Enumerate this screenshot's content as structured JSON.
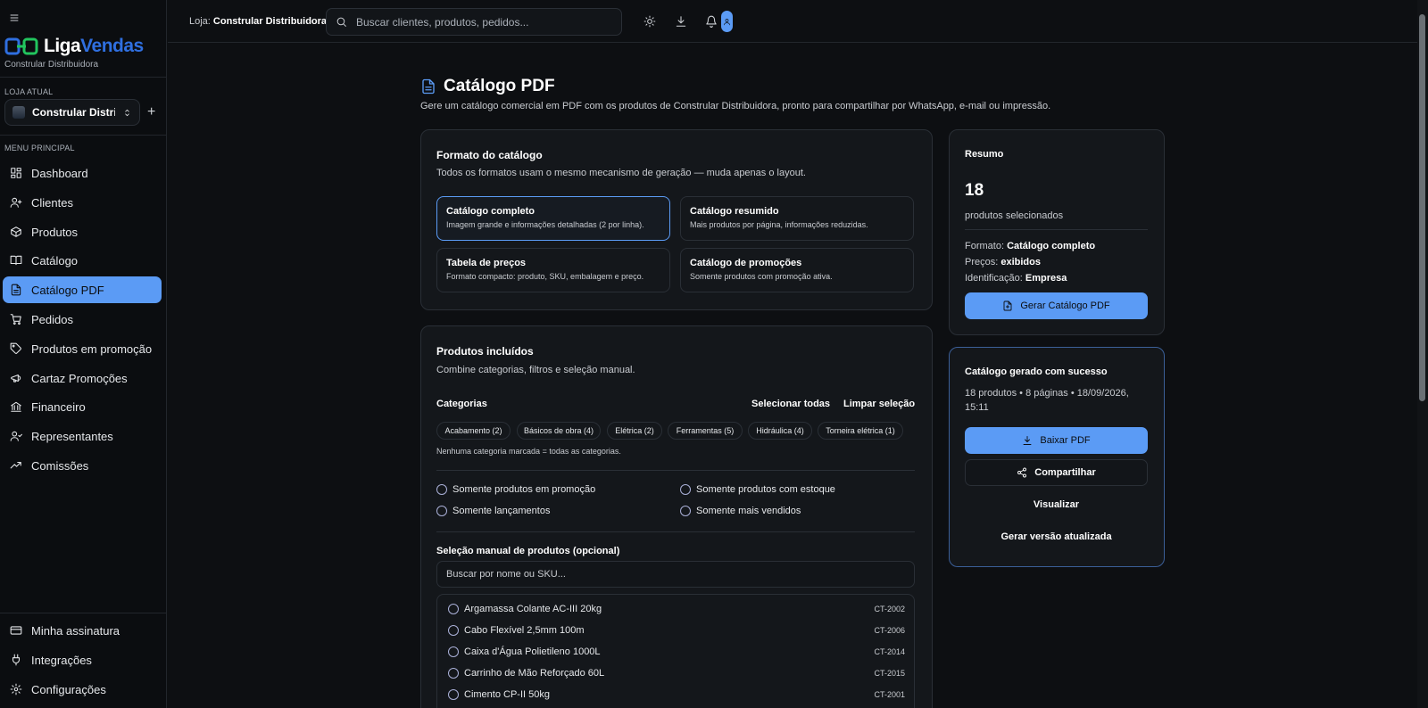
{
  "app": {
    "brand_part1": "Liga",
    "brand_part2": "Vendas",
    "store_subtitle": "Constrular Distribuidora"
  },
  "sidebar": {
    "current_store_label": "LOJA ATUAL",
    "current_store_name": "Constrular Distrib...",
    "main_menu_label": "MENU PRINCIPAL",
    "items": [
      {
        "label": "Dashboard",
        "icon": "dashboard-icon"
      },
      {
        "label": "Clientes",
        "icon": "user-plus-icon"
      },
      {
        "label": "Produtos",
        "icon": "box-icon"
      },
      {
        "label": "Catálogo",
        "icon": "book-open-icon"
      },
      {
        "label": "Catálogo PDF",
        "icon": "file-text-icon",
        "active": true
      },
      {
        "label": "Pedidos",
        "icon": "cart-icon"
      },
      {
        "label": "Produtos em promoção",
        "icon": "tag-icon"
      },
      {
        "label": "Cartaz Promoções",
        "icon": "megaphone-icon"
      },
      {
        "label": "Financeiro",
        "icon": "bank-icon"
      },
      {
        "label": "Representantes",
        "icon": "users-icon"
      },
      {
        "label": "Comissões",
        "icon": "trending-up-icon"
      }
    ],
    "bottom_items": [
      {
        "label": "Minha assinatura",
        "icon": "credit-card-icon"
      },
      {
        "label": "Integrações",
        "icon": "plug-icon"
      },
      {
        "label": "Configurações",
        "icon": "gear-icon"
      }
    ]
  },
  "topbar": {
    "store_prefix": "Loja:",
    "store_name": "Constrular Distribuidora",
    "search_placeholder": "Buscar clientes, produtos, pedidos..."
  },
  "page": {
    "title": "Catálogo PDF",
    "description": "Gere um catálogo comercial em PDF com os produtos de Constrular Distribuidora, pronto para compartilhar por WhatsApp, e-mail ou impressão."
  },
  "format_card": {
    "title": "Formato do catálogo",
    "subtitle": "Todos os formatos usam o mesmo mecanismo de geração — muda apenas o layout.",
    "options": [
      {
        "title": "Catálogo completo",
        "desc": "Imagem grande e informações detalhadas (2 por linha).",
        "selected": true
      },
      {
        "title": "Catálogo resumido",
        "desc": "Mais produtos por página, informações reduzidas.",
        "selected": false
      },
      {
        "title": "Tabela de preços",
        "desc": "Formato compacto: produto, SKU, embalagem e preço.",
        "selected": false
      },
      {
        "title": "Catálogo de promoções",
        "desc": "Somente produtos com promoção ativa.",
        "selected": false
      }
    ]
  },
  "products_card": {
    "title": "Produtos incluídos",
    "subtitle": "Combine categorias, filtros e seleção manual.",
    "categories_label": "Categorias",
    "select_all": "Selecionar todas",
    "clear_selection": "Limpar seleção",
    "categories": [
      "Acabamento (2)",
      "Básicos de obra (4)",
      "Elétrica (2)",
      "Ferramentas (5)",
      "Hidráulica (4)",
      "Torneira elétrica (1)"
    ],
    "categories_hint": "Nenhuma categoria marcada = todas as categorias.",
    "filters": [
      "Somente produtos em promoção",
      "Somente produtos com estoque",
      "Somente lançamentos",
      "Somente mais vendidos"
    ],
    "manual_label": "Seleção manual de produtos (opcional)",
    "manual_placeholder": "Buscar por nome ou SKU...",
    "products": [
      {
        "name": "Argamassa Colante AC-III 20kg",
        "sku": "CT-2002"
      },
      {
        "name": "Cabo Flexível 2,5mm 100m",
        "sku": "CT-2006"
      },
      {
        "name": "Caixa d'Água Polietileno 1000L",
        "sku": "CT-2014"
      },
      {
        "name": "Carrinho de Mão Reforçado 60L",
        "sku": "CT-2015"
      },
      {
        "name": "Cimento CP-II 50kg",
        "sku": "CT-2001"
      }
    ]
  },
  "summary": {
    "title": "Resumo",
    "count": "18",
    "count_label": "produtos selecionados",
    "format_label": "Formato:",
    "format_value": "Catálogo completo",
    "prices_label": "Preços:",
    "prices_value": "exibidos",
    "id_label": "Identificação:",
    "id_value": "Empresa",
    "generate_button": "Gerar Catálogo PDF"
  },
  "success": {
    "title": "Catálogo gerado com sucesso",
    "meta": "18 produtos • 8 páginas • 18/09/2026, 15:11",
    "download_button": "Baixar PDF",
    "share_button": "Compartilhar",
    "view_button": "Visualizar",
    "regenerate_button": "Gerar versão atualizada"
  },
  "colors": {
    "accent": "#5b9bf5",
    "brand_blue": "#2f6fe0",
    "background": "#0d0f12",
    "card": "#14171b",
    "border": "#2a2f36"
  }
}
